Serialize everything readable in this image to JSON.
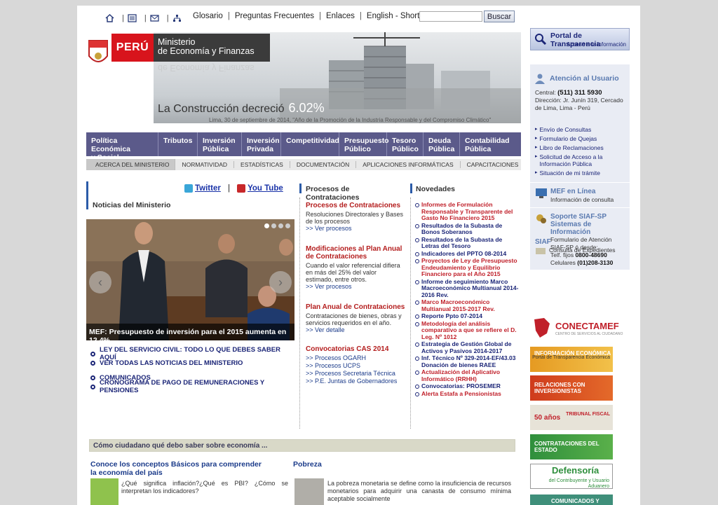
{
  "topbar": {
    "icons": [
      "home-icon",
      "sitemap-icon",
      "mail-icon",
      "org-chart-icon"
    ],
    "links": [
      "Glosario",
      "Preguntas Frecuentes",
      "Enlaces",
      "English - Short version"
    ],
    "search_button": "Buscar"
  },
  "banner": {
    "country": "PERÚ",
    "ministry_line1": "Ministerio",
    "ministry_line2": "de Economía y Finanzas",
    "reflection": "de Economía y Finanzas",
    "caption": "La Construcción decreció",
    "caption_value": "6.02%",
    "subcaption": "Lima, 30 de septiembre de 2014,   \"Año de la Promoción de la Industria Responsable y del Compromiso Climático\""
  },
  "nav": {
    "items": [
      [
        "Política Económica",
        "y Social"
      ],
      [
        "Tributos",
        ""
      ],
      [
        "Inversión",
        "Pública"
      ],
      [
        "Inversión",
        "Privada"
      ],
      [
        "Competitividad",
        ""
      ],
      [
        "Presupuesto",
        "Público"
      ],
      [
        "Tesoro",
        "Público"
      ],
      [
        "Deuda",
        "Pública"
      ],
      [
        "Contabilidad",
        "Pública"
      ]
    ],
    "subitems": [
      "ACERCA DEL MINISTERIO",
      "NORMATIVIDAD",
      "ESTADÍSTICAS",
      "DOCUMENTACIÓN",
      "APLICACIONES INFORMÁTICAS",
      "CAPACITACIONES"
    ]
  },
  "noticias": {
    "twitter": "Twitter",
    "youtube": "You Tube",
    "title": "Noticias del Ministerio",
    "slide_caption": "MEF: Presupuesto de inversión para el 2015 aumenta en 12.4%",
    "links": [
      "LEY DEL SERVICIO CIVIL: TODO LO QUE DEBES SABER AQUÍ",
      "VER TODAS LAS NOTICIAS DEL MINISTERIO",
      "COMUNICADOS",
      "CRONOGRAMA DE PAGO DE REMUNERACIONES Y PENSIONES"
    ]
  },
  "procesos": {
    "title": "Procesos de Contrataciones",
    "groups": [
      {
        "title": "Procesos de Contrataciones",
        "desc": "Resoluciones Directorales y Bases de los procesos",
        "links": [
          ">> Ver  procesos"
        ]
      },
      {
        "title": "Modificaciones al Plan Anual de Contrataciones",
        "desc": "Cuando el valor referencial difiera en más del 25% del valor estimado, entre otros.",
        "links": [
          ">> Ver  procesos"
        ]
      },
      {
        "title": "Plan Anual de Contrataciones",
        "desc": "Contrataciones de bienes, obras y servicios requeridos en el año.",
        "links": [
          ">> Ver detalle"
        ]
      },
      {
        "title": "Convocatorias CAS 2014",
        "desc": "",
        "links": [
          ">> Procesos OGARH",
          ">> Procesos UCPS",
          ">> Procesos Secretaria Técnica",
          ">> P.E. Juntas de Gobernadores"
        ]
      }
    ]
  },
  "novedades": {
    "title": "Novedades",
    "items": [
      {
        "text": "Informes de Formulación Responsable y Transparente del Gasto No Financiero 2015",
        "color": "red"
      },
      {
        "text": "Resultados de la Subasta de Bonos Soberanos",
        "color": "blue"
      },
      {
        "text": "Resultados de la Subasta de Letras del Tesoro",
        "color": "blue"
      },
      {
        "text": "Indicadores del PPTO 08-2014",
        "color": "blue"
      },
      {
        "text": "Proyectos de Ley de Presupuesto Endeudamiento y Equilibrio Financiero para el Año 2015",
        "color": "red"
      },
      {
        "text": "Informe de seguimiento Marco Macroeconómico Multianual 2014-2016 Rev.",
        "color": "blue"
      },
      {
        "text": "Marco Macroeconómico Multianual 2015-2017 Rev.",
        "color": "red"
      },
      {
        "text": "Reporte Ppto 07-2014",
        "color": "blue"
      },
      {
        "text": "Metodología del análisis comparativo a que se refiere el D. Leg. Nº 1012",
        "color": "red"
      },
      {
        "text": "Estrategia de Gestión Global de Activos y Pasivos 2014-2017",
        "color": "blue"
      },
      {
        "text": "Inf. Técnico Nº 329-2014-EF/43.03 Donación de bienes RAEE",
        "color": "blue"
      },
      {
        "text": "Actualización del Aplicativo Informático (RRHH)",
        "color": "red"
      },
      {
        "text": "Convocatorias: PROSEMER",
        "color": "blue"
      },
      {
        "text": "Alerta Estafa a Pensionistas",
        "color": "red"
      }
    ]
  },
  "ciudadano": {
    "header": "Cómo ciudadano qué debo saber sobre economía ...",
    "t1": "Conoce los conceptos Básicos para comprender la economía del país",
    "d1": "¿Qué significa inflación?¿Qué es PBI? ¿Cómo se interpretan los indicadores?",
    "t2": "Pobreza",
    "d2": "La pobreza monetaria se define como la insuficiencia de recursos monetarios para adquirir una canasta de consumo mínima aceptable socialmente"
  },
  "sidebar": {
    "transparencia_title": "Portal de Transparencia",
    "transparencia_sub": "Acceso a la información",
    "atencion_title": "Atención al Usuario",
    "central_label": "Central:",
    "central_phone": "(511) 311 5930",
    "direccion": "Dirección: Jr. Junín 319, Cercado de Lima, Lima - Perú",
    "links": [
      "Envío de Consultas",
      "Formulario de Quejas",
      "Libro de Reclamaciones",
      "Solicitud de Acceso a la Información Pública",
      "Situación de mi trámite"
    ],
    "mef_title": "MEF en Línea",
    "mef_sub": "Información de consulta",
    "siaf_title": "Soporte SIAF-SP Sistemas de Información",
    "siaf_desc": "Formulario de Atención SIAF-SP ó desde:",
    "siaf_tel_label": "Telf. fijos",
    "siaf_tel": "0800-48690",
    "siaf_cel_label": "Celulares",
    "siaf_cel": "(01)208-3130",
    "siaf2_title": "SIAF",
    "siaf2_sub": "Consulta de Expedientes",
    "conecta": "CONECTAMEF",
    "conecta_sub": "CENTRO DE SERVICIOS AL CIUDADANO",
    "banners": [
      {
        "title": "INFORMACIÓN ECONÓMICA",
        "sub": "Portal de Transparencia Económica"
      },
      {
        "title": "RELACIONES CON INVERSIONISTAS",
        "sub": ""
      },
      {
        "title": "50 años",
        "sub": "TRIBUNAL FISCAL"
      },
      {
        "title": "CONTRATACIONES DEL ESTADO",
        "sub": ""
      },
      {
        "title": "Defensoría",
        "sub": "del Contribuyente y Usuario Aduanero"
      },
      {
        "title": "COMUNICADOS Y NOTAS DE PRENSA",
        "sub": ""
      }
    ]
  }
}
